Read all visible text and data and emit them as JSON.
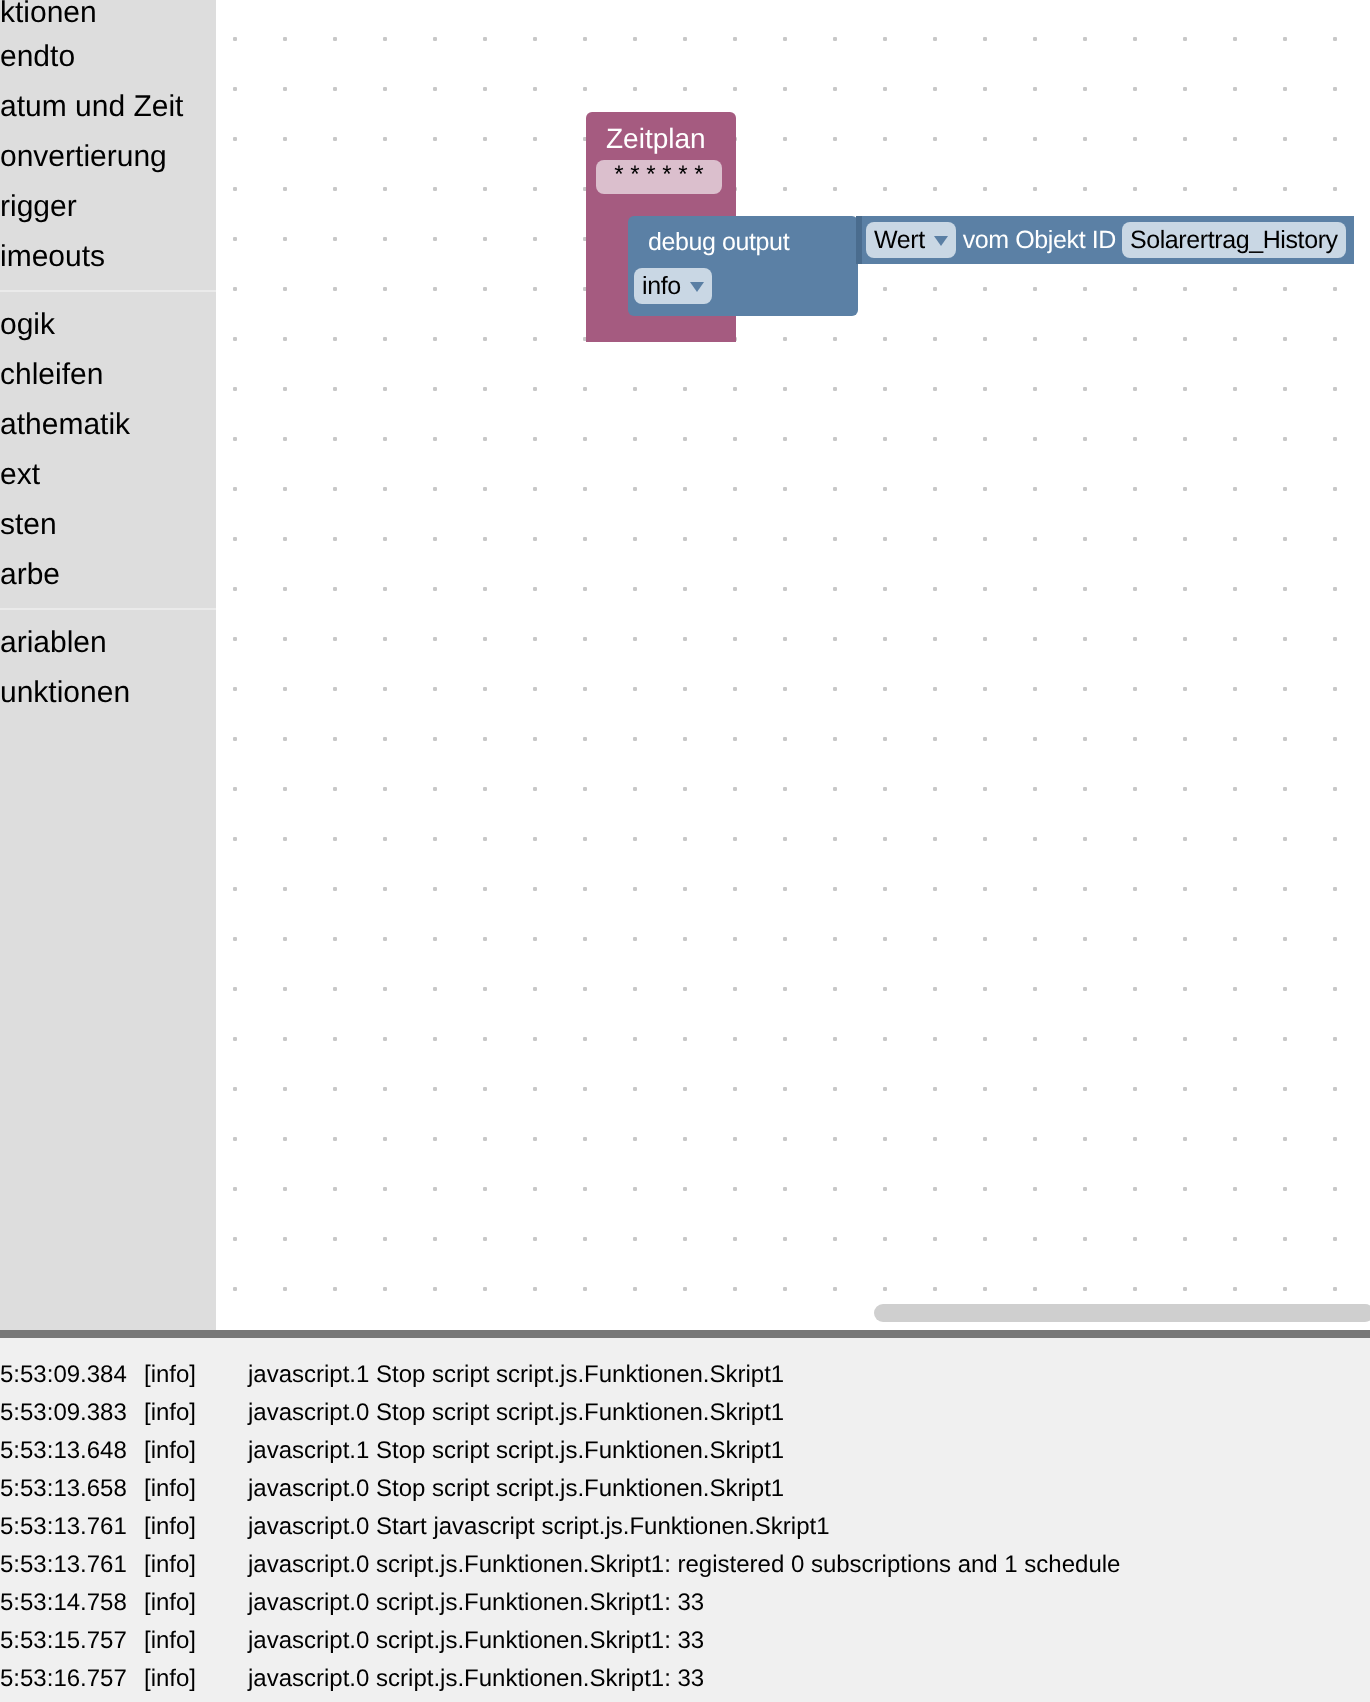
{
  "sidebar": {
    "groups": [
      {
        "items": [
          "ktionen",
          "endto",
          "atum und Zeit",
          "onvertierung",
          "rigger",
          "imeouts"
        ]
      },
      {
        "items": [
          "ogik",
          "chleifen",
          "athematik",
          "ext",
          "sten",
          "arbe"
        ]
      },
      {
        "items": [
          "ariablen",
          "unktionen"
        ]
      }
    ]
  },
  "workspace": {
    "schedule_block": {
      "title": "Zeitplan",
      "pattern": "* * * * * *"
    },
    "debug_block": {
      "label": "debug output",
      "value_dropdown": "Wert",
      "object_label": "vom Objekt ID",
      "object_id": "Solarertrag_History",
      "level_dropdown": "info"
    }
  },
  "log": {
    "rows": [
      {
        "time": "5:53:09.384",
        "level": "[info]",
        "message": "javascript.1 Stop script script.js.Funktionen.Skript1"
      },
      {
        "time": "5:53:09.383",
        "level": "[info]",
        "message": "javascript.0 Stop script script.js.Funktionen.Skript1"
      },
      {
        "time": "5:53:13.648",
        "level": "[info]",
        "message": "javascript.1 Stop script script.js.Funktionen.Skript1"
      },
      {
        "time": "5:53:13.658",
        "level": "[info]",
        "message": "javascript.0 Stop script script.js.Funktionen.Skript1"
      },
      {
        "time": "5:53:13.761",
        "level": "[info]",
        "message": "javascript.0 Start javascript script.js.Funktionen.Skript1"
      },
      {
        "time": "5:53:13.761",
        "level": "[info]",
        "message": "javascript.0 script.js.Funktionen.Skript1: registered 0 subscriptions and 1 schedule"
      },
      {
        "time": "5:53:14.758",
        "level": "[info]",
        "message": "javascript.0 script.js.Funktionen.Skript1: 33"
      },
      {
        "time": "5:53:15.757",
        "level": "[info]",
        "message": "javascript.0 script.js.Funktionen.Skript1: 33"
      },
      {
        "time": "5:53:16.757",
        "level": "[info]",
        "message": "javascript.0 script.js.Funktionen.Skript1: 33"
      }
    ]
  }
}
